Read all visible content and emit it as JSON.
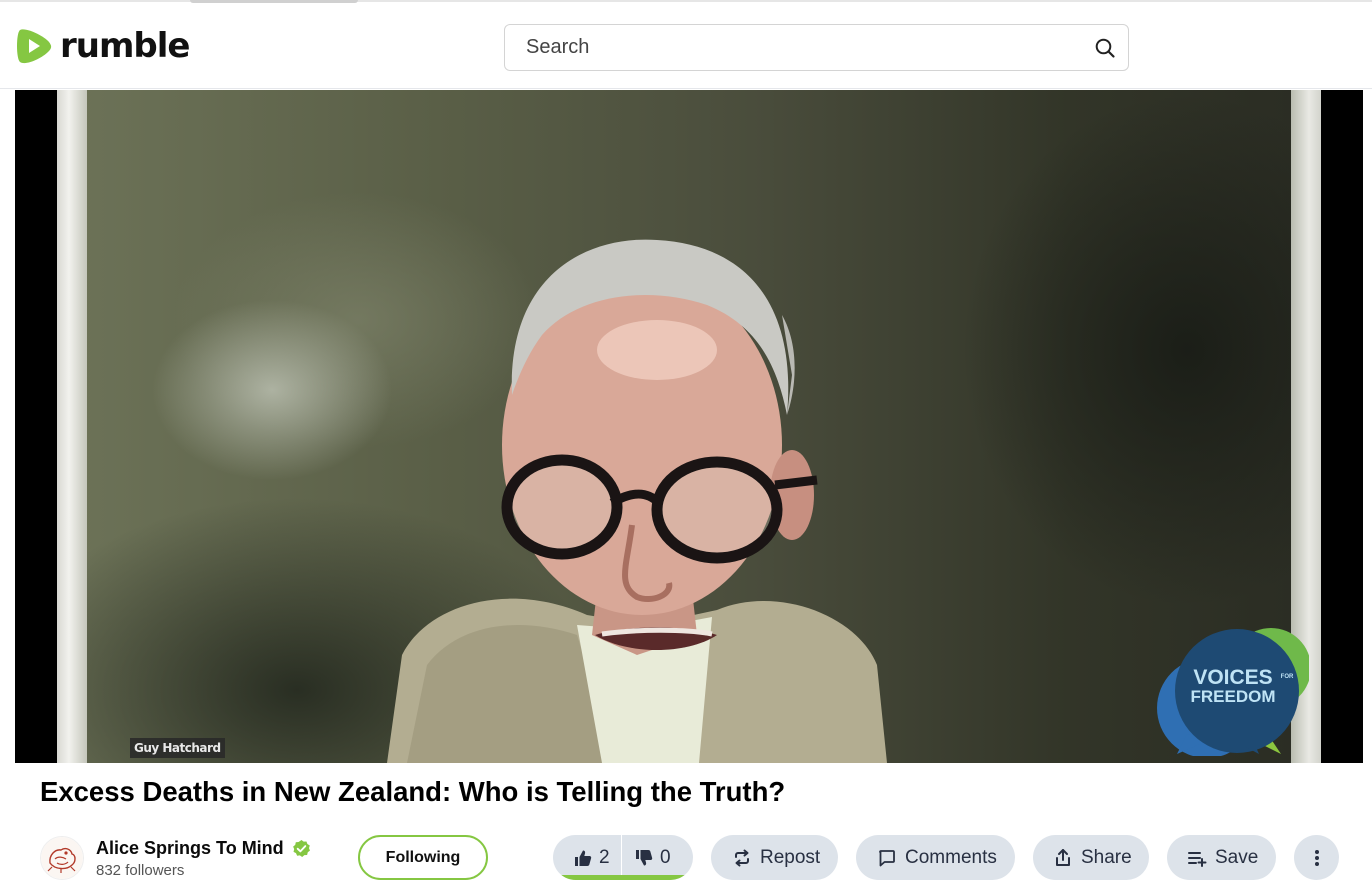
{
  "header": {
    "logo_text": "rumble",
    "search": {
      "placeholder": "Search"
    }
  },
  "player": {
    "name_tag": "Guy Hatchard",
    "watermark_line1": "VOICES",
    "watermark_small": "FOR",
    "watermark_line2": "FREEDOM"
  },
  "video": {
    "title": "Excess Deaths in New Zealand: Who is Telling the Truth?"
  },
  "channel": {
    "name": "Alice Springs To Mind",
    "followers": "832 followers",
    "follow_label": "Following"
  },
  "actions": {
    "likes": "2",
    "dislikes": "0",
    "repost_label": "Repost",
    "comments_label": "Comments",
    "share_label": "Share",
    "save_label": "Save"
  },
  "colors": {
    "brand_green": "#85c742",
    "pill_bg": "#dde3ea"
  }
}
